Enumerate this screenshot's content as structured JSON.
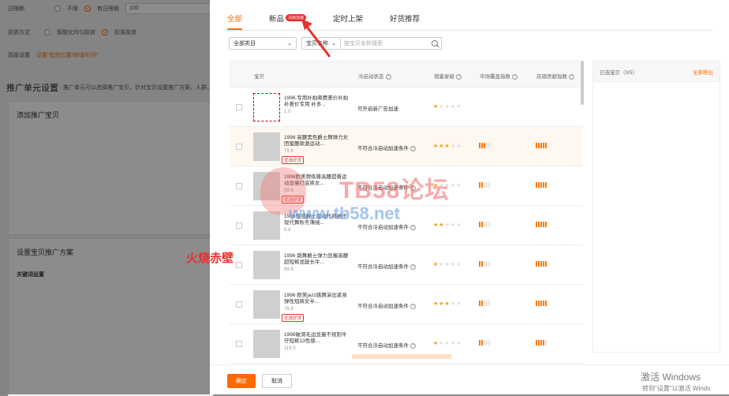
{
  "background": {
    "row1": {
      "label": "日限额",
      "opt1": "不限",
      "opt2": "有日限额",
      "value": "100"
    },
    "row2": {
      "label": "投放方式",
      "opt1": "智能化均匀投放",
      "opt2": "标准投放"
    },
    "row3": {
      "label": "高级设置",
      "link": "设置\"投放位置/地域/时间\""
    },
    "section1": "推广单元设置",
    "section1_sub": "推广单元可以选择推广宝贝，针对宝贝设置推广方案，人群，创意",
    "panel1_title": "添加推广宝贝",
    "panel2_title": "设置宝贝推广方案",
    "panel2_sub": "关键词设置"
  },
  "tabs": [
    {
      "label": "全部",
      "active": true
    },
    {
      "label": "新品",
      "badge": "冷启加速"
    },
    {
      "label": "定时上架"
    },
    {
      "label": "好货推荐"
    }
  ],
  "filters": {
    "category": "全部类目",
    "field": "宝贝名称",
    "search_placeholder": "按宝贝名称搜索"
  },
  "table": {
    "headers": {
      "item": "宝贝",
      "status": "冷启动状态",
      "sales": "销量星级",
      "market": "市场覆盖指数",
      "store": "店铺贡献指数"
    },
    "rows": [
      {
        "title": "1996.专用补拍邮费差价补拍 补差价专用 补多...",
        "price": "1.0",
        "status": "可开启新广告加速",
        "stars": 1,
        "market": 0,
        "store": 0,
        "tag": ""
      },
      {
        "title": "1996 高腰黑色爵士舞弹力女团蜜腰款激运动...",
        "price": "79.9",
        "status": "不符合冷启动加速条件",
        "stars": 3,
        "market": 3,
        "store": 5,
        "tag": "优选好货"
      },
      {
        "title": "1996欧美牌练臀高腰提臀运动显瘦打底裤女...",
        "price": "99.9",
        "status": "不符合冷启动加速条件",
        "stars": 1,
        "market": 2,
        "store": 5,
        "tag": "优选好货"
      },
      {
        "title": "1996性感爵士运动开衩裙子现代舞秋冬薄绒...",
        "price": "9.9",
        "status": "不符合冷启动加速条件",
        "stars": 2,
        "market": 2,
        "store": 5,
        "tag": ""
      },
      {
        "title": "1996 跳舞爵士弹力显瘦高腰超短裤显腿长牛...",
        "price": "89.9",
        "status": "不符合冷启动加速条件",
        "stars": 1,
        "market": 2,
        "store": 5,
        "tag": ""
      },
      {
        "title": "1996 欧美jazz跳舞演出紧身弹性短裤女半...",
        "price": "79.9",
        "status": "不符合冷启动加速条件",
        "stars": 3,
        "market": 2,
        "store": 5,
        "tag": "优选好货"
      },
      {
        "title": "1996破洞毛边显瘦不规则牛仔短裤13性感...",
        "price": "119.0",
        "status": "不符合冷启动加速条件",
        "stars": 1,
        "market": 2,
        "store": 4,
        "tag": ""
      }
    ]
  },
  "selected_panel": {
    "label": "已选宝贝（0/5）",
    "clear": "全部移出"
  },
  "buttons": {
    "ok": "确定",
    "cancel": "取消"
  },
  "overlay_text": "火烧赤壁",
  "watermark": {
    "line1": "TB58论坛",
    "line2": "www.tb58.net"
  },
  "windows": {
    "line1": "激活 Windows",
    "line2": "转到\"设置\"以激活 Windo"
  }
}
